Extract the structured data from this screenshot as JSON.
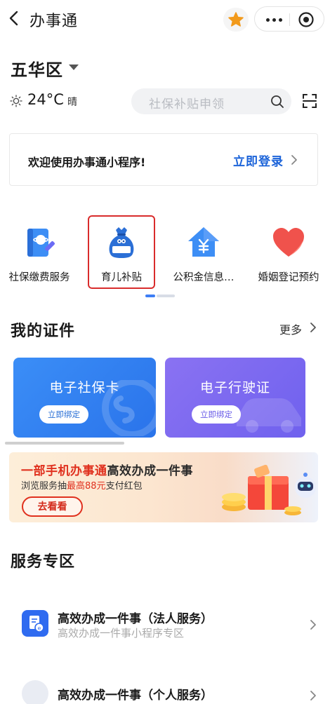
{
  "nav": {
    "title": "办事通"
  },
  "location": {
    "district": "五华区"
  },
  "weather": {
    "temperature": "24°C",
    "condition": "晴"
  },
  "search": {
    "placeholder": "社保补贴申领"
  },
  "login_card": {
    "text": "欢迎使用办事通小程序!",
    "link": "立即登录"
  },
  "services": [
    {
      "label": "社保缴费服务",
      "icon": "social-security-book-icon"
    },
    {
      "label": "育儿补贴",
      "icon": "childcare-subsidy-bag-icon",
      "highlighted": true
    },
    {
      "label": "公积金信息…",
      "icon": "housing-fund-house-icon"
    },
    {
      "label": "婚姻登记预约",
      "icon": "heart-icon"
    }
  ],
  "certificates": {
    "title": "我的证件",
    "more": "更多",
    "cards": [
      {
        "title": "电子社保卡",
        "button": "立即绑定",
        "color": "#2f86f0"
      },
      {
        "title": "电子行驶证",
        "button": "立即绑定",
        "color": "#7b6bf0"
      }
    ]
  },
  "banner": {
    "title_highlight": "一部手机办事通",
    "title_rest": "高效办成一件事",
    "sub_prefix": "浏览服务抽",
    "sub_highlight": "最高88元",
    "sub_suffix": "支付红包",
    "button": "去看看"
  },
  "service_zone": {
    "title": "服务专区",
    "items": [
      {
        "title": "高效办成一件事（法人服务）",
        "subtitle": "高效办成一件事小程序专区"
      },
      {
        "title": "高效办成一件事（个人服务）",
        "subtitle": ""
      }
    ]
  },
  "colors": {
    "brand_blue": "#1b63d9",
    "highlight_red": "#d92c2c",
    "star_orange": "#f29a1b"
  }
}
